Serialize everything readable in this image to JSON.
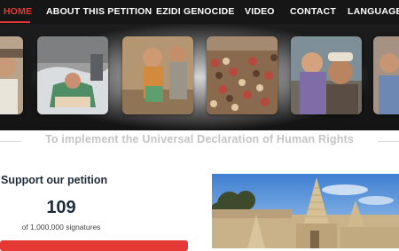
{
  "nav": {
    "items": [
      {
        "label": "HOME",
        "active": true
      },
      {
        "label": "ABOUT THIS PETITION",
        "active": false
      },
      {
        "label": "EZIDI GENOCIDE",
        "active": false
      },
      {
        "label": "VIDEO",
        "active": false
      },
      {
        "label": "CONTACT",
        "active": false
      },
      {
        "label": "LANGUAGES",
        "active": false
      }
    ]
  },
  "tagline": "To implement the Universal Declaration of Human Rights",
  "petition": {
    "heading": "Support our petition",
    "count": "109",
    "goal_text": "of 1,000,000 signatures"
  },
  "colors": {
    "accent": "#e53935",
    "nav_bg": "#161616",
    "heading": "#1f2b3a"
  }
}
